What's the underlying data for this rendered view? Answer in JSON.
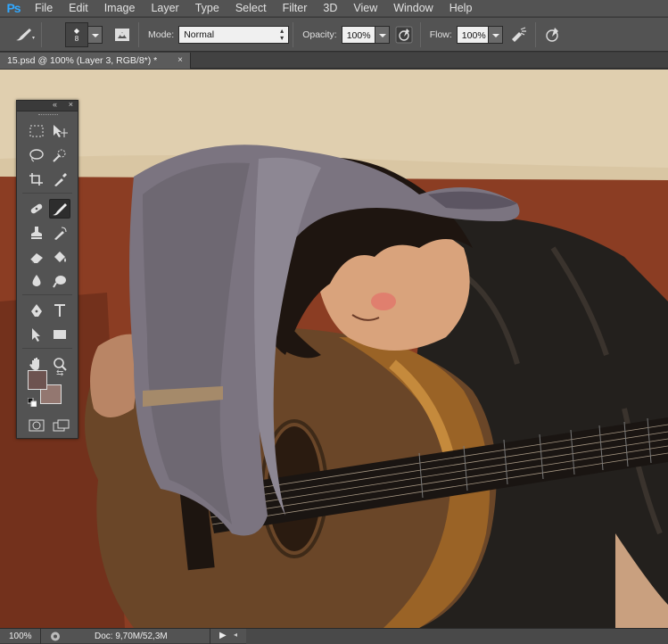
{
  "app": {
    "logo": "Ps"
  },
  "menu": [
    "File",
    "Edit",
    "Image",
    "Layer",
    "Type",
    "Select",
    "Filter",
    "3D",
    "View",
    "Window",
    "Help"
  ],
  "options": {
    "brush_size": "8",
    "mode_label": "Mode:",
    "mode_value": "Normal",
    "opacity_label": "Opacity:",
    "opacity_value": "100%",
    "flow_label": "Flow:",
    "flow_value": "100%"
  },
  "document": {
    "tab_title": "15.psd @ 100% (Layer 3, RGB/8*) *",
    "close": "×"
  },
  "tools_panel": {
    "collapse": "«",
    "close": "×",
    "active_tool": "brush-tool",
    "foreground_color": "#6d5350",
    "background_color": "#937770"
  },
  "status": {
    "zoom": "100%",
    "doc_info": "Doc: 9,70M/52,3M"
  },
  "colors": {
    "ui_dark": "#535353",
    "accent": "#31a8ff"
  }
}
